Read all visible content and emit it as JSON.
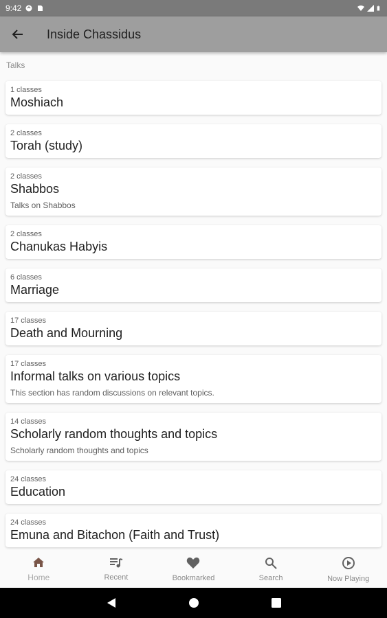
{
  "status_bar": {
    "time": "9:42"
  },
  "app_bar": {
    "title": "Inside Chassidus"
  },
  "section_label": "Talks",
  "items": [
    {
      "count": "1 classes",
      "title": "Moshiach",
      "desc": ""
    },
    {
      "count": "2 classes",
      "title": "Torah (study)",
      "desc": ""
    },
    {
      "count": "2 classes",
      "title": "Shabbos",
      "desc": "Talks on Shabbos"
    },
    {
      "count": "2 classes",
      "title": "Chanukas Habyis",
      "desc": ""
    },
    {
      "count": "6 classes",
      "title": "Marriage",
      "desc": ""
    },
    {
      "count": "17 classes",
      "title": "Death and Mourning",
      "desc": ""
    },
    {
      "count": "17 classes",
      "title": "Informal talks on various topics",
      "desc": "This section has random discussions on relevant topics."
    },
    {
      "count": "14 classes",
      "title": "Scholarly random thoughts and topics",
      "desc": "Scholarly random thoughts and topics"
    },
    {
      "count": "24 classes",
      "title": "Education",
      "desc": ""
    },
    {
      "count": "24 classes",
      "title": "Emuna and Bitachon (Faith and Trust)",
      "desc": ""
    }
  ],
  "bottom_nav": [
    {
      "label": "Home",
      "icon": "home-icon",
      "active": true
    },
    {
      "label": "Recent",
      "icon": "playlist-icon",
      "active": false
    },
    {
      "label": "Bookmarked",
      "icon": "heart-icon",
      "active": false
    },
    {
      "label": "Search",
      "icon": "search-icon",
      "active": false
    },
    {
      "label": "Now Playing",
      "icon": "play-circle-icon",
      "active": false
    }
  ],
  "colors": {
    "app_bar": "#9e9e9e",
    "status_bar": "#7a7a7a",
    "home_icon": "#795548",
    "icon_gray": "#616161"
  }
}
